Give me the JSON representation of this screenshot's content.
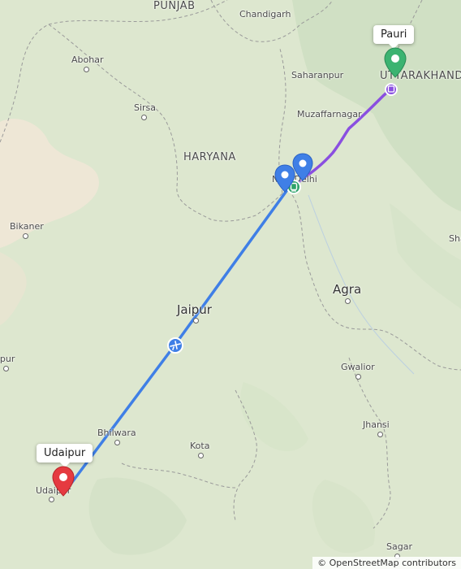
{
  "map": {
    "places": {
      "punjab": "PUNJAB",
      "chandigarh": "Chandigarh",
      "abohar": "Abohar",
      "sirsa": "Sirsa",
      "haryana": "HARYANA",
      "saharanpur": "Saharanpur",
      "muzaffarnagar": "Muzaffarnagar",
      "uttarakhand": "UTTARAKHAND",
      "new_delhi": "New Delhi",
      "bikaner": "Bikaner",
      "agra": "Agra",
      "jaipur": "Jaipur",
      "jodhpur": "Jodhpur",
      "gwalior": "Gwalior",
      "bhilwara": "Bhilwara",
      "jhansi": "Jhansi",
      "kota": "Kota",
      "udaipur_city": "Udaipur",
      "sagar": "Sagar",
      "sha": "Sha"
    },
    "markers": {
      "start_label": "Pauri",
      "end_label": "Udaipur"
    },
    "colors": {
      "start_pin": "#3cb371",
      "end_pin": "#e53a40",
      "mid_pin": "#3f7fe6",
      "drive_route": "#8a4fe0",
      "flight_route": "#3f7fe6"
    },
    "icons": {
      "start": "map-pin-icon",
      "end": "map-pin-icon",
      "plane": "airplane-icon",
      "train": "train-icon",
      "bus": "bus-icon"
    },
    "attribution": "© OpenStreetMap contributors"
  }
}
